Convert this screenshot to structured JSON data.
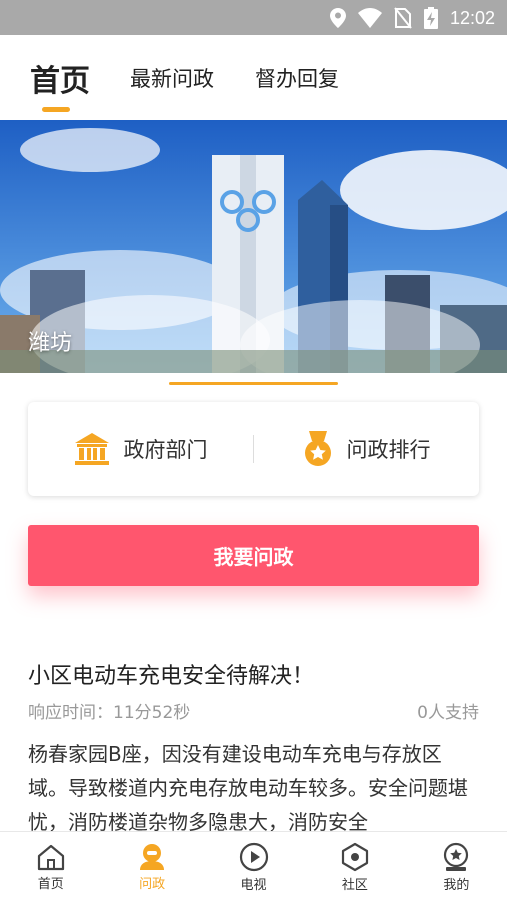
{
  "status_bar": {
    "time": "12:02"
  },
  "tabs": [
    {
      "label": "首页"
    },
    {
      "label": "最新问政"
    },
    {
      "label": "督办回复"
    }
  ],
  "banner": {
    "caption": "潍坊"
  },
  "quick_links": [
    {
      "label": "政府部门",
      "icon": "government-icon"
    },
    {
      "label": "问政排行",
      "icon": "ranking-medal-icon"
    }
  ],
  "ask_button": {
    "label": "我要问政"
  },
  "article": {
    "title": "小区电动车充电安全待解决！",
    "response_time": "响应时间：11分52秒",
    "support": "0人支持",
    "body": "杨春家园B座，因没有建设电动车充电与存放区域。导致楼道内充电存放电动车较多。安全问题堪忧，消防楼道杂物多隐患大，消防安全"
  },
  "bottom_nav": [
    {
      "label": "首页",
      "icon": "home-icon"
    },
    {
      "label": "问政",
      "icon": "inquiry-icon"
    },
    {
      "label": "电视",
      "icon": "tv-play-icon"
    },
    {
      "label": "社区",
      "icon": "community-icon"
    },
    {
      "label": "我的",
      "icon": "profile-icon"
    }
  ],
  "colors": {
    "accent": "#f5a623",
    "primary_button": "#ff566e",
    "status_bar": "#a9a9a9"
  }
}
